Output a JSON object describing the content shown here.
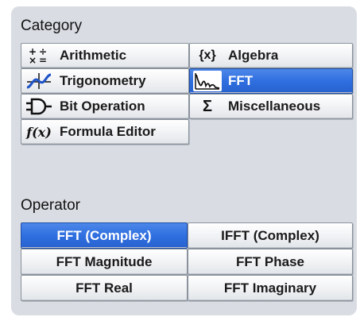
{
  "category": {
    "title": "Category",
    "items": [
      {
        "label": "Arithmetic",
        "icon": "arithmetic-icon",
        "selected": false
      },
      {
        "label": "Algebra",
        "icon": "braces-x-icon",
        "selected": false
      },
      {
        "label": "Trigonometry",
        "icon": "sine-wave-icon",
        "selected": false
      },
      {
        "label": "FFT",
        "icon": "fft-spectrum-icon",
        "selected": true
      },
      {
        "label": "Bit Operation",
        "icon": "logic-gate-icon",
        "selected": false
      },
      {
        "label": "Miscellaneous",
        "icon": "sigma-icon",
        "selected": false
      },
      {
        "label": "Formula Editor",
        "icon": "formula-fx-icon",
        "selected": false
      }
    ],
    "icon_glyphs": {
      "algebra": "{x}",
      "misc": "Σ",
      "formula": "f(x)"
    }
  },
  "operator": {
    "title": "Operator",
    "items": [
      {
        "label": "FFT (Complex)",
        "selected": true
      },
      {
        "label": "IFFT (Complex)",
        "selected": false
      },
      {
        "label": "FFT Magnitude",
        "selected": false
      },
      {
        "label": "FFT Phase",
        "selected": false
      },
      {
        "label": "FFT Real",
        "selected": false
      },
      {
        "label": "FFT Imaginary",
        "selected": false
      }
    ]
  },
  "colors": {
    "panel": "#d9dde3",
    "selected": "#2f6fe0",
    "button": "#f3f4f6"
  }
}
